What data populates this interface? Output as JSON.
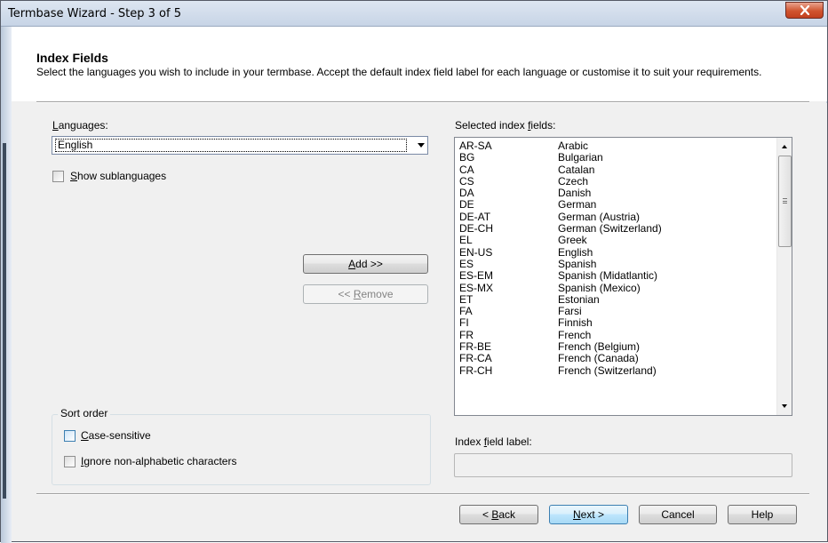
{
  "window": {
    "title": "Termbase Wizard - Step 3 of 5"
  },
  "header": {
    "title": "Index Fields",
    "description": "Select the languages you wish to include in your termbase. Accept the default index field label for each language or customise it to suit your requirements."
  },
  "languages": {
    "label_pre": "",
    "label_accel": "L",
    "label_post": "anguages:",
    "selected": "English",
    "show_sublanguages_pre": "",
    "show_sublanguages_accel": "S",
    "show_sublanguages_post": "how sublanguages",
    "show_sublanguages_checked": false
  },
  "buttons": {
    "add_pre": "",
    "add_accel": "A",
    "add_post": "dd >>",
    "remove_pre": "<< ",
    "remove_accel": "R",
    "remove_post": "emove",
    "back_pre": "< ",
    "back_accel": "B",
    "back_post": "ack",
    "next_pre": "",
    "next_accel": "N",
    "next_post": "ext >",
    "cancel": "Cancel",
    "help": "Help"
  },
  "index_fields": {
    "label_pre": "Selected index ",
    "label_accel": "f",
    "label_post": "ields:",
    "items": [
      {
        "code": "AR-SA",
        "name": "Arabic"
      },
      {
        "code": "BG",
        "name": "Bulgarian"
      },
      {
        "code": "CA",
        "name": "Catalan"
      },
      {
        "code": "CS",
        "name": "Czech"
      },
      {
        "code": "DA",
        "name": "Danish"
      },
      {
        "code": "DE",
        "name": "German"
      },
      {
        "code": "DE-AT",
        "name": "German (Austria)"
      },
      {
        "code": "DE-CH",
        "name": "German (Switzerland)"
      },
      {
        "code": "EL",
        "name": "Greek"
      },
      {
        "code": "EN-US",
        "name": "English"
      },
      {
        "code": "ES",
        "name": "Spanish"
      },
      {
        "code": "ES-EM",
        "name": "Spanish (Midatlantic)"
      },
      {
        "code": "ES-MX",
        "name": "Spanish (Mexico)"
      },
      {
        "code": "ET",
        "name": "Estonian"
      },
      {
        "code": "FA",
        "name": "Farsi"
      },
      {
        "code": "FI",
        "name": "Finnish"
      },
      {
        "code": "FR",
        "name": "French"
      },
      {
        "code": "FR-BE",
        "name": "French (Belgium)"
      },
      {
        "code": "FR-CA",
        "name": "French (Canada)"
      },
      {
        "code": "FR-CH",
        "name": "French (Switzerland)"
      }
    ],
    "field_label_pre": "Index ",
    "field_label_accel": "f",
    "field_label_post": "ield label:",
    "field_label_value": ""
  },
  "sort_order": {
    "title": "Sort order",
    "case_sensitive_pre": "",
    "case_sensitive_accel": "C",
    "case_sensitive_post": "ase-sensitive",
    "case_sensitive_checked": false,
    "ignore_pre": "",
    "ignore_accel": "I",
    "ignore_post": "gnore non-alphabetic characters",
    "ignore_checked": false
  },
  "icons": {
    "close": "close-icon",
    "dropdown": "chevron-down-icon",
    "scroll_up": "scroll-up-icon",
    "scroll_down": "scroll-down-icon"
  },
  "colors": {
    "close_button": "#c9482a",
    "default_button_border": "#3c7fb1",
    "dialog_background": "#f0f0f0"
  }
}
